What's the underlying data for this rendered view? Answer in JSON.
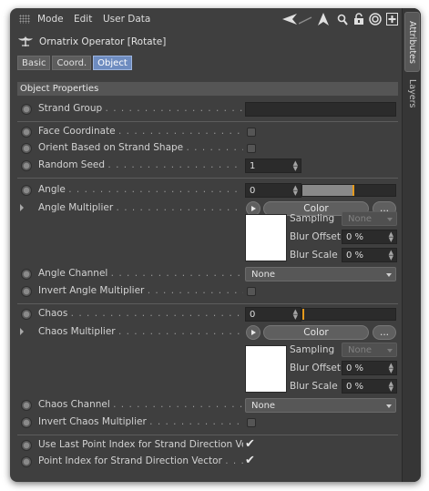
{
  "menu": {
    "mode": "Mode",
    "edit": "Edit",
    "user_data": "User Data"
  },
  "toolbar_icons": [
    "back-arrow-icon",
    "forward-arrow-icon",
    "search-icon",
    "lock-icon",
    "target-icon",
    "new-panel-icon"
  ],
  "title": "Ornatrix Operator [Rotate]",
  "tabs": [
    "Basic",
    "Coord.",
    "Object"
  ],
  "active_tab": "Object",
  "section_header": "Object Properties",
  "fields": {
    "strand_group": {
      "label": "Strand Group",
      "value": ""
    },
    "face_coordinate": {
      "label": "Face Coordinate",
      "checked": false
    },
    "orient_based": {
      "label": "Orient Based on Strand Shape",
      "checked": false
    },
    "random_seed": {
      "label": "Random Seed",
      "value": "1"
    },
    "angle": {
      "label": "Angle",
      "value": "0",
      "slider_fill": 0.55
    },
    "angle_multiplier": {
      "label": "Angle Multiplier",
      "button": "Color",
      "more": "..."
    },
    "angle_sub": {
      "sampling_label": "Sampling",
      "sampling_value": "None",
      "blur_offset_label": "Blur Offset",
      "blur_offset_value": "0 %",
      "blur_scale_label": "Blur Scale",
      "blur_scale_value": "0 %"
    },
    "angle_channel": {
      "label": "Angle Channel",
      "value": "None"
    },
    "invert_angle": {
      "label": "Invert Angle Multiplier",
      "checked": false
    },
    "chaos": {
      "label": "Chaos",
      "value": "0",
      "slider_fill": 0.0
    },
    "chaos_multiplier": {
      "label": "Chaos Multiplier",
      "button": "Color",
      "more": "..."
    },
    "chaos_sub": {
      "sampling_label": "Sampling",
      "sampling_value": "None",
      "blur_offset_label": "Blur Offset",
      "blur_offset_value": "0 %",
      "blur_scale_label": "Blur Scale",
      "blur_scale_value": "0 %"
    },
    "chaos_channel": {
      "label": "Chaos Channel",
      "value": "None"
    },
    "invert_chaos": {
      "label": "Invert Chaos Multiplier",
      "checked": false
    },
    "use_last_point": {
      "label": "Use Last Point Index for Strand Direction Vector",
      "checked": true
    },
    "point_index": {
      "label": "Point Index for Strand Direction Vector",
      "checked": true
    }
  },
  "side_tabs": {
    "attributes": "Attributes",
    "layers": "Layers"
  },
  "colors": {
    "panel_bg": "#3f3f3f",
    "active_tab": "#6e8cc0",
    "slider_marker": "#e59a1c",
    "field_bg": "#2b2b2b"
  }
}
